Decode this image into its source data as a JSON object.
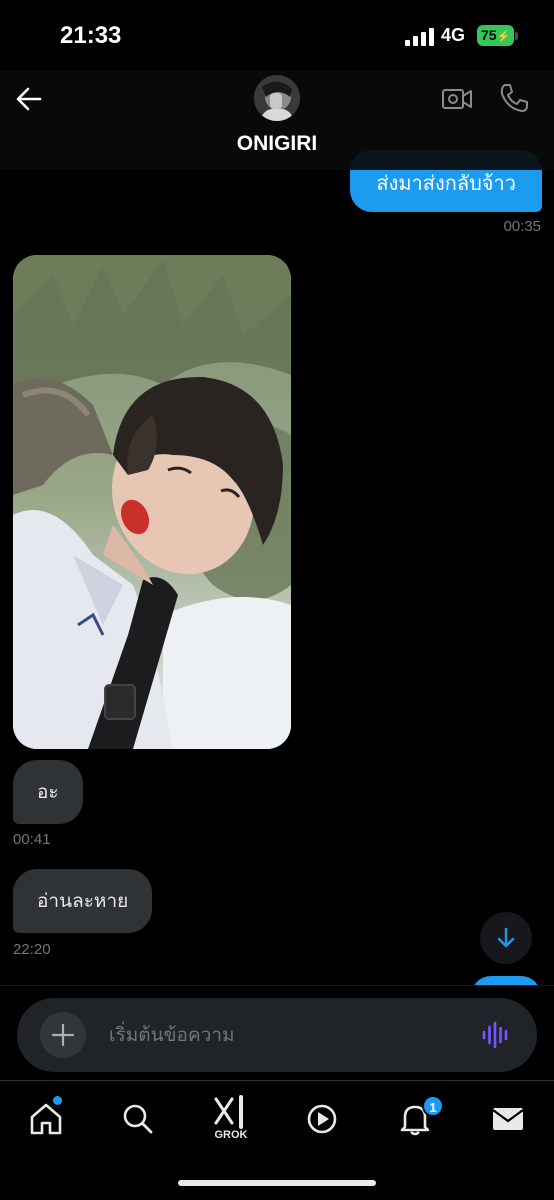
{
  "status_bar": {
    "time": "21:33",
    "network": "4G",
    "battery": "75"
  },
  "header": {
    "contact_name": "ONIGIRI"
  },
  "messages": [
    {
      "direction": "out",
      "text": "ส่งมาส่งกลับจ้าว",
      "time": "00:35"
    },
    {
      "direction": "in",
      "type": "image",
      "description": "selfie photo"
    },
    {
      "direction": "in",
      "text": "อะ",
      "time": "00:41"
    },
    {
      "direction": "in",
      "text": "อ่านละหาย",
      "time": "22:20"
    }
  ],
  "composer": {
    "placeholder": "เริ่มต้นข้อความ"
  },
  "tabbar": {
    "grok_label": "GROK",
    "notifications_badge": "1",
    "items": [
      "home-icon",
      "search-icon",
      "grok-icon",
      "video-icon",
      "bell-icon",
      "mail-icon"
    ]
  },
  "colors": {
    "accent": "#1d9bf0",
    "bubble_in": "#2f3336",
    "background": "#000000",
    "battery": "#34c759",
    "voice": "#7856ff"
  }
}
